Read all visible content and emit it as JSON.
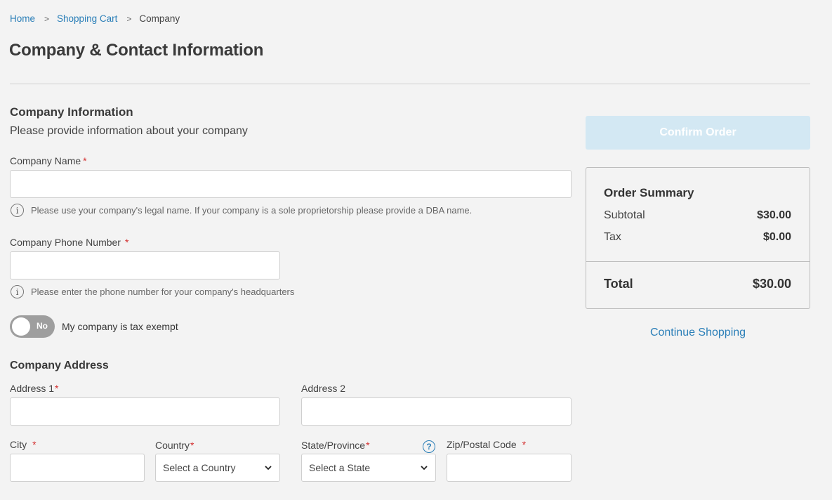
{
  "breadcrumb": {
    "home": "Home",
    "cart": "Shopping Cart",
    "current": "Company",
    "separator": ">"
  },
  "page_title": "Company & Contact Information",
  "company_info": {
    "title": "Company Information",
    "subtitle": "Please provide information about your company",
    "name_label": "Company Name",
    "name_hint": "Please use your company's legal name. If your company is a sole proprietorship please provide a DBA name.",
    "phone_label": "Company Phone Number",
    "phone_hint": "Please enter the phone number for your company's headquarters",
    "tax_toggle_state": "No",
    "tax_toggle_label": "My company is tax exempt",
    "required_mark": "*",
    "info_icon_glyph": "i"
  },
  "address": {
    "title": "Company Address",
    "address1_label": "Address 1",
    "address2_label": "Address 2",
    "city_label": "City",
    "country_label": "Country",
    "country_selected": "Select a Country",
    "state_label": "State/Province",
    "state_selected": "Select a State",
    "zip_label": "Zip/Postal Code",
    "help_icon_glyph": "?"
  },
  "order": {
    "confirm_label": "Confirm Order",
    "summary_title": "Order Summary",
    "subtotal_label": "Subtotal",
    "subtotal_value": "$30.00",
    "tax_label": "Tax",
    "tax_value": "$0.00",
    "total_label": "Total",
    "total_value": "$30.00",
    "continue_label": "Continue Shopping"
  },
  "colors": {
    "link": "#2b7fb8",
    "required": "#d32f2f",
    "confirm_disabled_bg": "#d3e8f3",
    "toggle_off": "#9e9e9e",
    "background": "#f3f3f3"
  },
  "icons": [
    "info-icon",
    "help-icon",
    "chevron-down-icon"
  ]
}
